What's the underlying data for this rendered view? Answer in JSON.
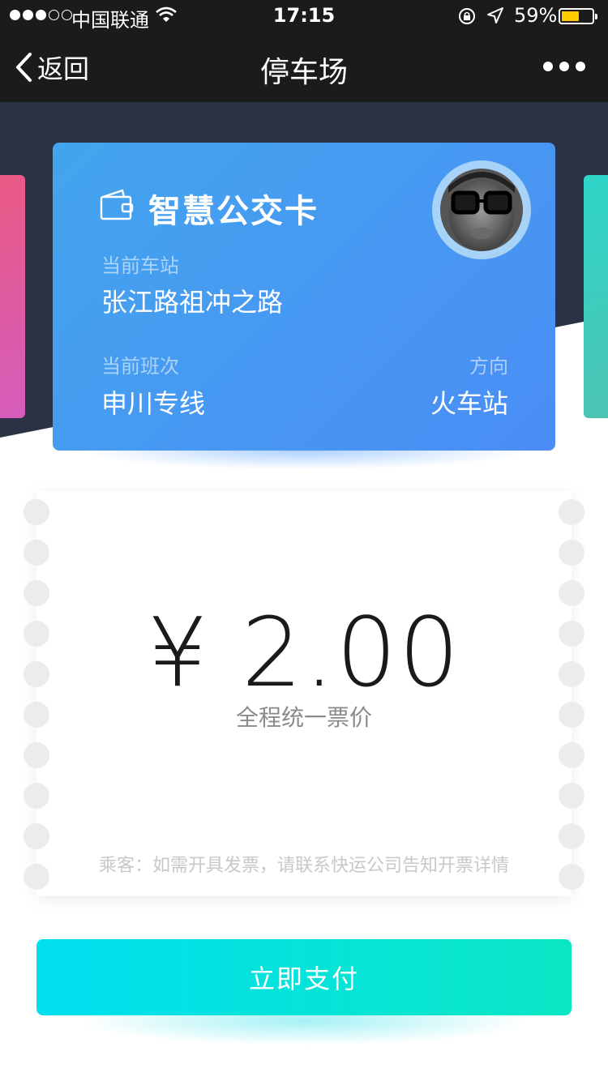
{
  "status_bar": {
    "carrier": "中国联通",
    "time": "17:15",
    "battery_percent": "59%",
    "battery_level": 0.59
  },
  "nav": {
    "back_label": "返回",
    "title": "停车场"
  },
  "card": {
    "title": "智慧公交卡",
    "current_station_label": "当前车站",
    "current_station": "张江路祖冲之路",
    "current_route_label": "当前班次",
    "current_route": "申川专线",
    "direction_label": "方向",
    "direction": "火车站"
  },
  "ticket": {
    "price": "¥ 2.00",
    "price_note": "全程统一票价",
    "invoice_note": "乘客：如需开具发票，请联系快运公司告知开票详情"
  },
  "pay_button": {
    "label": "立即支付"
  },
  "colors": {
    "card_gradient_start": "#43a5ee",
    "card_gradient_end": "#4a8df5",
    "pay_gradient_start": "#00e0f0",
    "pay_gradient_end": "#0ae6c4",
    "battery": "#ffcc00"
  }
}
